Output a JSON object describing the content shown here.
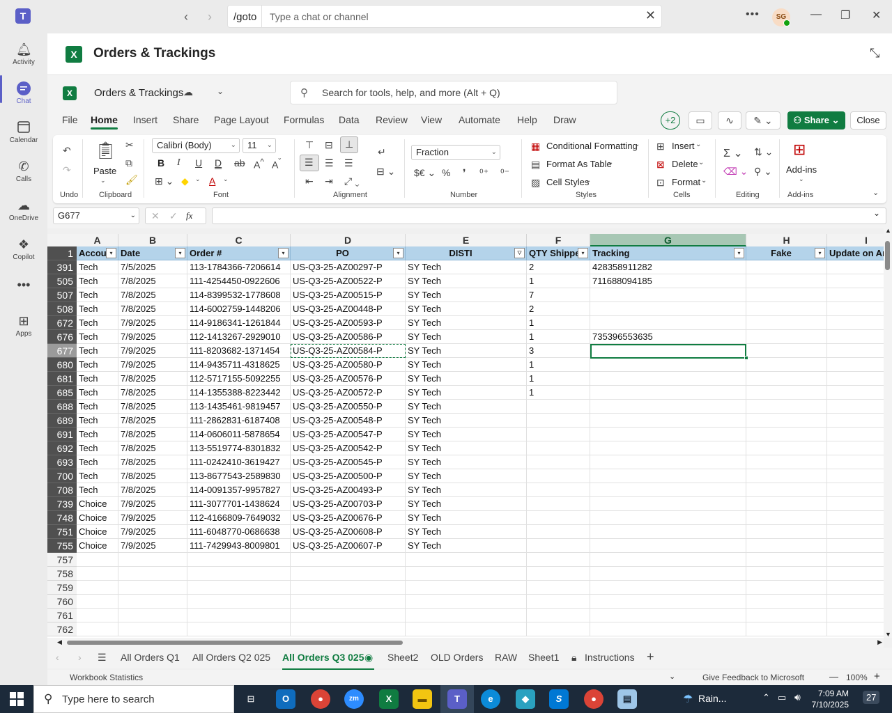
{
  "teams": {
    "goto_label": "/goto",
    "search_placeholder": "Type a chat or channel",
    "avatar_initials": "SG",
    "rail": [
      {
        "label": "Activity",
        "icon": "bell-icon"
      },
      {
        "label": "Chat",
        "icon": "chat-icon"
      },
      {
        "label": "Calendar",
        "icon": "calendar-icon"
      },
      {
        "label": "Calls",
        "icon": "phone-icon"
      },
      {
        "label": "OneDrive",
        "icon": "cloud-icon"
      },
      {
        "label": "Copilot",
        "icon": "copilot-icon"
      },
      {
        "label": "Apps",
        "icon": "apps-plus-icon"
      }
    ],
    "app_title": "Orders & Trackings"
  },
  "excel": {
    "workbook_name": "Orders & Trackings",
    "search_placeholder": "Search for tools, help, and more (Alt + Q)",
    "tabs": [
      "File",
      "Home",
      "Insert",
      "Share",
      "Page Layout",
      "Formulas",
      "Data",
      "Review",
      "View",
      "Automate",
      "Help",
      "Draw"
    ],
    "collaborators": "+2",
    "share_label": "Share",
    "close_label": "Close",
    "ribbon": {
      "undo_group": "Undo",
      "clipboard_group": "Clipboard",
      "paste_label": "Paste",
      "font_group": "Font",
      "font_name": "Calibri (Body)",
      "font_size": "11",
      "alignment_group": "Alignment",
      "number_group": "Number",
      "number_format": "Fraction",
      "currency_symbol": "$€",
      "styles_group": "Styles",
      "conditional_formatting": "Conditional Formatting",
      "format_as_table": "Format As Table",
      "cell_styles": "Cell Styles",
      "cells_group": "Cells",
      "insert": "Insert",
      "delete": "Delete",
      "format": "Format",
      "editing_group": "Editing",
      "addins_label": "Add-ins",
      "addins_group": "Add-ins"
    },
    "name_box": "G677",
    "formula_value": "",
    "columns": [
      "A",
      "B",
      "C",
      "D",
      "E",
      "F",
      "G",
      "H",
      "I"
    ],
    "header_row_number": "1",
    "headers": [
      "Accou",
      "Date",
      "Order #",
      "PO",
      "DISTI",
      "QTY Shipped",
      "Tracking",
      "Fake",
      "Update on Ar"
    ],
    "rows": [
      {
        "n": "391",
        "cells": [
          "Tech",
          "7/5/2025",
          "113-1784366-7206614",
          "US-Q3-25-AZ00297-P",
          "SY Tech",
          "2",
          "428358911282",
          "",
          ""
        ]
      },
      {
        "n": "505",
        "cells": [
          "Tech",
          "7/8/2025",
          "111-4254450-0922606",
          "US-Q3-25-AZ00522-P",
          "SY Tech",
          "1",
          "711688094185",
          "",
          ""
        ]
      },
      {
        "n": "507",
        "cells": [
          "Tech",
          "7/8/2025",
          "114-8399532-1778608",
          "US-Q3-25-AZ00515-P",
          "SY Tech",
          "7",
          "",
          "",
          ""
        ]
      },
      {
        "n": "508",
        "cells": [
          "Tech",
          "7/8/2025",
          "114-6002759-1448206",
          "US-Q3-25-AZ00448-P",
          "SY Tech",
          "2",
          "",
          "",
          ""
        ]
      },
      {
        "n": "672",
        "cells": [
          "Tech",
          "7/9/2025",
          "114-9186341-1261844",
          "US-Q3-25-AZ00593-P",
          "SY Tech",
          "1",
          "",
          "",
          ""
        ]
      },
      {
        "n": "676",
        "cells": [
          "Tech",
          "7/9/2025",
          "112-1413267-2929010",
          "US-Q3-25-AZ00586-P",
          "SY Tech",
          "1",
          "735396553635",
          "",
          ""
        ]
      },
      {
        "n": "677",
        "cells": [
          "Tech",
          "7/9/2025",
          "111-8203682-1371454",
          "US-Q3-25-AZ00584-P",
          "SY Tech",
          "3",
          "",
          "",
          ""
        ]
      },
      {
        "n": "680",
        "cells": [
          "Tech",
          "7/9/2025",
          "114-9435711-4318625",
          "US-Q3-25-AZ00580-P",
          "SY Tech",
          "1",
          "",
          "",
          ""
        ]
      },
      {
        "n": "681",
        "cells": [
          "Tech",
          "7/8/2025",
          "112-5717155-5092255",
          "US-Q3-25-AZ00576-P",
          "SY Tech",
          "1",
          "",
          "",
          ""
        ]
      },
      {
        "n": "685",
        "cells": [
          "Tech",
          "7/8/2025",
          "114-1355388-8223442",
          "US-Q3-25-AZ00572-P",
          "SY Tech",
          "1",
          "",
          "",
          ""
        ]
      },
      {
        "n": "688",
        "cells": [
          "Tech",
          "7/8/2025",
          "113-1435461-9819457",
          "US-Q3-25-AZ00550-P",
          "SY Tech",
          "",
          "",
          "",
          ""
        ]
      },
      {
        "n": "689",
        "cells": [
          "Tech",
          "7/8/2025",
          "111-2862831-6187408",
          "US-Q3-25-AZ00548-P",
          "SY Tech",
          "",
          "",
          "",
          ""
        ]
      },
      {
        "n": "691",
        "cells": [
          "Tech",
          "7/8/2025",
          "114-0606011-5878654",
          "US-Q3-25-AZ00547-P",
          "SY Tech",
          "",
          "",
          "",
          ""
        ]
      },
      {
        "n": "692",
        "cells": [
          "Tech",
          "7/8/2025",
          "113-5519774-8301832",
          "US-Q3-25-AZ00542-P",
          "SY Tech",
          "",
          "",
          "",
          ""
        ]
      },
      {
        "n": "693",
        "cells": [
          "Tech",
          "7/8/2025",
          "111-0242410-3619427",
          "US-Q3-25-AZ00545-P",
          "SY Tech",
          "",
          "",
          "",
          ""
        ]
      },
      {
        "n": "700",
        "cells": [
          "Tech",
          "7/8/2025",
          "113-8677543-2589830",
          "US-Q3-25-AZ00500-P",
          "SY Tech",
          "",
          "",
          "",
          ""
        ]
      },
      {
        "n": "708",
        "cells": [
          "Tech",
          "7/8/2025",
          "114-0091357-9957827",
          "US-Q3-25-AZ00493-P",
          "SY Tech",
          "",
          "",
          "",
          ""
        ]
      },
      {
        "n": "739",
        "cells": [
          "Choice",
          "7/9/2025",
          "111-3077701-1438624",
          "US-Q3-25-AZ00703-P",
          "SY Tech",
          "",
          "",
          "",
          ""
        ]
      },
      {
        "n": "748",
        "cells": [
          "Choice",
          "7/9/2025",
          "112-4166809-7649032",
          "US-Q3-25-AZ00676-P",
          "SY Tech",
          "",
          "",
          "",
          ""
        ]
      },
      {
        "n": "751",
        "cells": [
          "Choice",
          "7/9/2025",
          "111-6048770-0686638",
          "US-Q3-25-AZ00608-P",
          "SY Tech",
          "",
          "",
          "",
          ""
        ]
      },
      {
        "n": "755",
        "cells": [
          "Choice",
          "7/9/2025",
          "111-7429943-8009801",
          "US-Q3-25-AZ00607-P",
          "SY Tech",
          "",
          "",
          "",
          ""
        ]
      },
      {
        "n": "757",
        "cells": [
          "",
          "",
          "",
          "",
          "",
          "",
          "",
          "",
          ""
        ]
      },
      {
        "n": "758",
        "cells": [
          "",
          "",
          "",
          "",
          "",
          "",
          "",
          "",
          ""
        ]
      },
      {
        "n": "759",
        "cells": [
          "",
          "",
          "",
          "",
          "",
          "",
          "",
          "",
          ""
        ]
      },
      {
        "n": "760",
        "cells": [
          "",
          "",
          "",
          "",
          "",
          "",
          "",
          "",
          ""
        ]
      },
      {
        "n": "761",
        "cells": [
          "",
          "",
          "",
          "",
          "",
          "",
          "",
          "",
          ""
        ]
      },
      {
        "n": "762",
        "cells": [
          "",
          "",
          "",
          "",
          "",
          "",
          "",
          "",
          ""
        ]
      }
    ],
    "selected_row": "677",
    "sheets": [
      "All Orders Q1",
      "All Orders Q2 025",
      "All Orders Q3 025",
      "Sheet2",
      "OLD Orders",
      "RAW",
      "Sheet1",
      "Instructions"
    ],
    "active_sheet": "All Orders Q3 025",
    "status_left": "Workbook Statistics",
    "feedback": "Give Feedback to Microsoft",
    "zoom": "100%"
  },
  "taskbar": {
    "search_placeholder": "Type here to search",
    "weather": "Rain...",
    "time": "7:09 AM",
    "date": "7/10/2025",
    "notifications": "27"
  },
  "colors": {
    "excel_green": "#107c41",
    "teams_purple": "#5b5fc7",
    "table_header_blue": "#b4d3ea"
  }
}
